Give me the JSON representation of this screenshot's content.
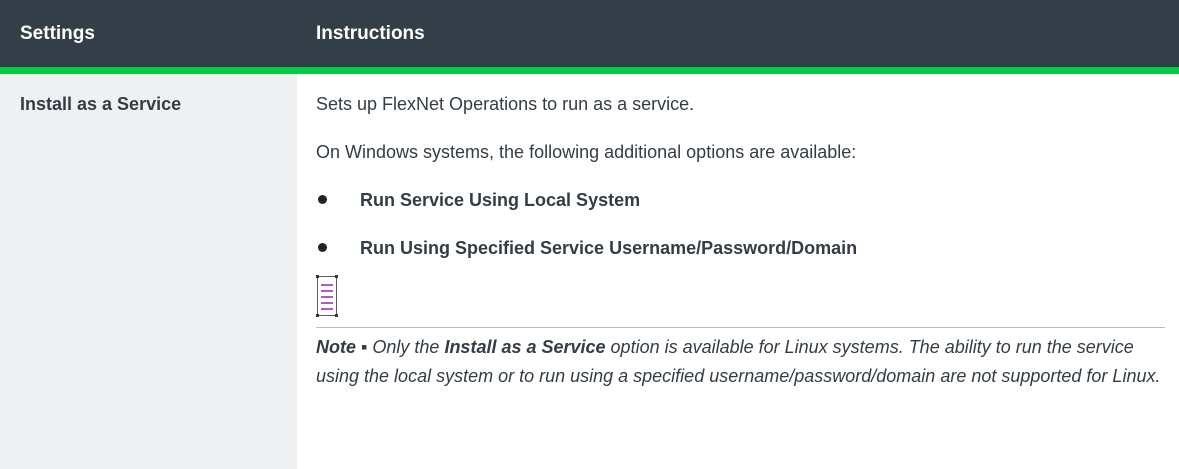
{
  "table": {
    "headers": {
      "settings": "Settings",
      "instructions": "Instructions"
    },
    "row": {
      "setting": "Install as a Service",
      "paragraphs": [
        "Sets up FlexNet Operations to run as a service.",
        "On Windows systems, the following additional options are available:"
      ],
      "bullets": [
        "Run Service Using Local System",
        "Run Using Specified Service Username/Password/Domain"
      ],
      "note": {
        "icon": "note-icon",
        "label": "Note",
        "separator": " ▪ ",
        "lead": "Only the ",
        "emphasis": "Install as a Service",
        "body": " option is available for Linux systems. The ability to run the service using the local system or to run using a specified username/password/domain are not supported for Linux."
      }
    }
  },
  "colors": {
    "header_bg": "#333e48",
    "header_accent": "#00cc44",
    "settings_column_bg": "#eff0f1",
    "note_icon_lines": "#b05ac8"
  }
}
